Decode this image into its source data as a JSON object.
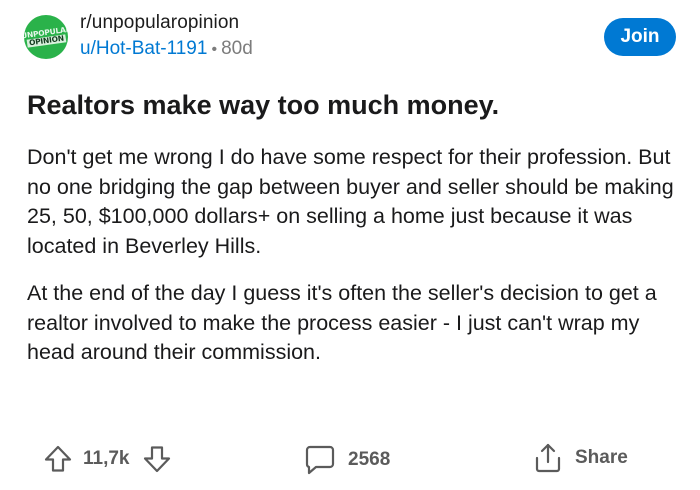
{
  "subreddit": {
    "name": "r/unpopularopinion",
    "avatar_line1": "UNPOPULAR",
    "avatar_line2": "OPINION",
    "avatar_color": "#2ab24a"
  },
  "post": {
    "author": "u/Hot-Bat-1191",
    "separator": "•",
    "age": "80d",
    "title": "Realtors make way too much money.",
    "paragraphs": [
      "Don't get me wrong I do have some respect for their profession. But no one bridging the gap between buyer and seller should be making 25, 50, $100,000 dollars+ on selling a home just because it was located in Beverley Hills.",
      "At the end of the day I guess it's often the seller's decision to get a realtor involved to make the process easier - I just can't wrap my head around their commission."
    ]
  },
  "header": {
    "join_label": "Join"
  },
  "actions": {
    "upvote_icon": "arrow-up-outline-icon",
    "downvote_icon": "arrow-down-outline-icon",
    "score": "11,7k",
    "comment_icon": "speech-bubble-icon",
    "comment_count": "2568",
    "share_icon": "share-upload-icon",
    "share_label": "Share"
  },
  "colors": {
    "accent": "#0079d3",
    "text": "#1a1a1b",
    "muted": "#7c7c7c"
  }
}
